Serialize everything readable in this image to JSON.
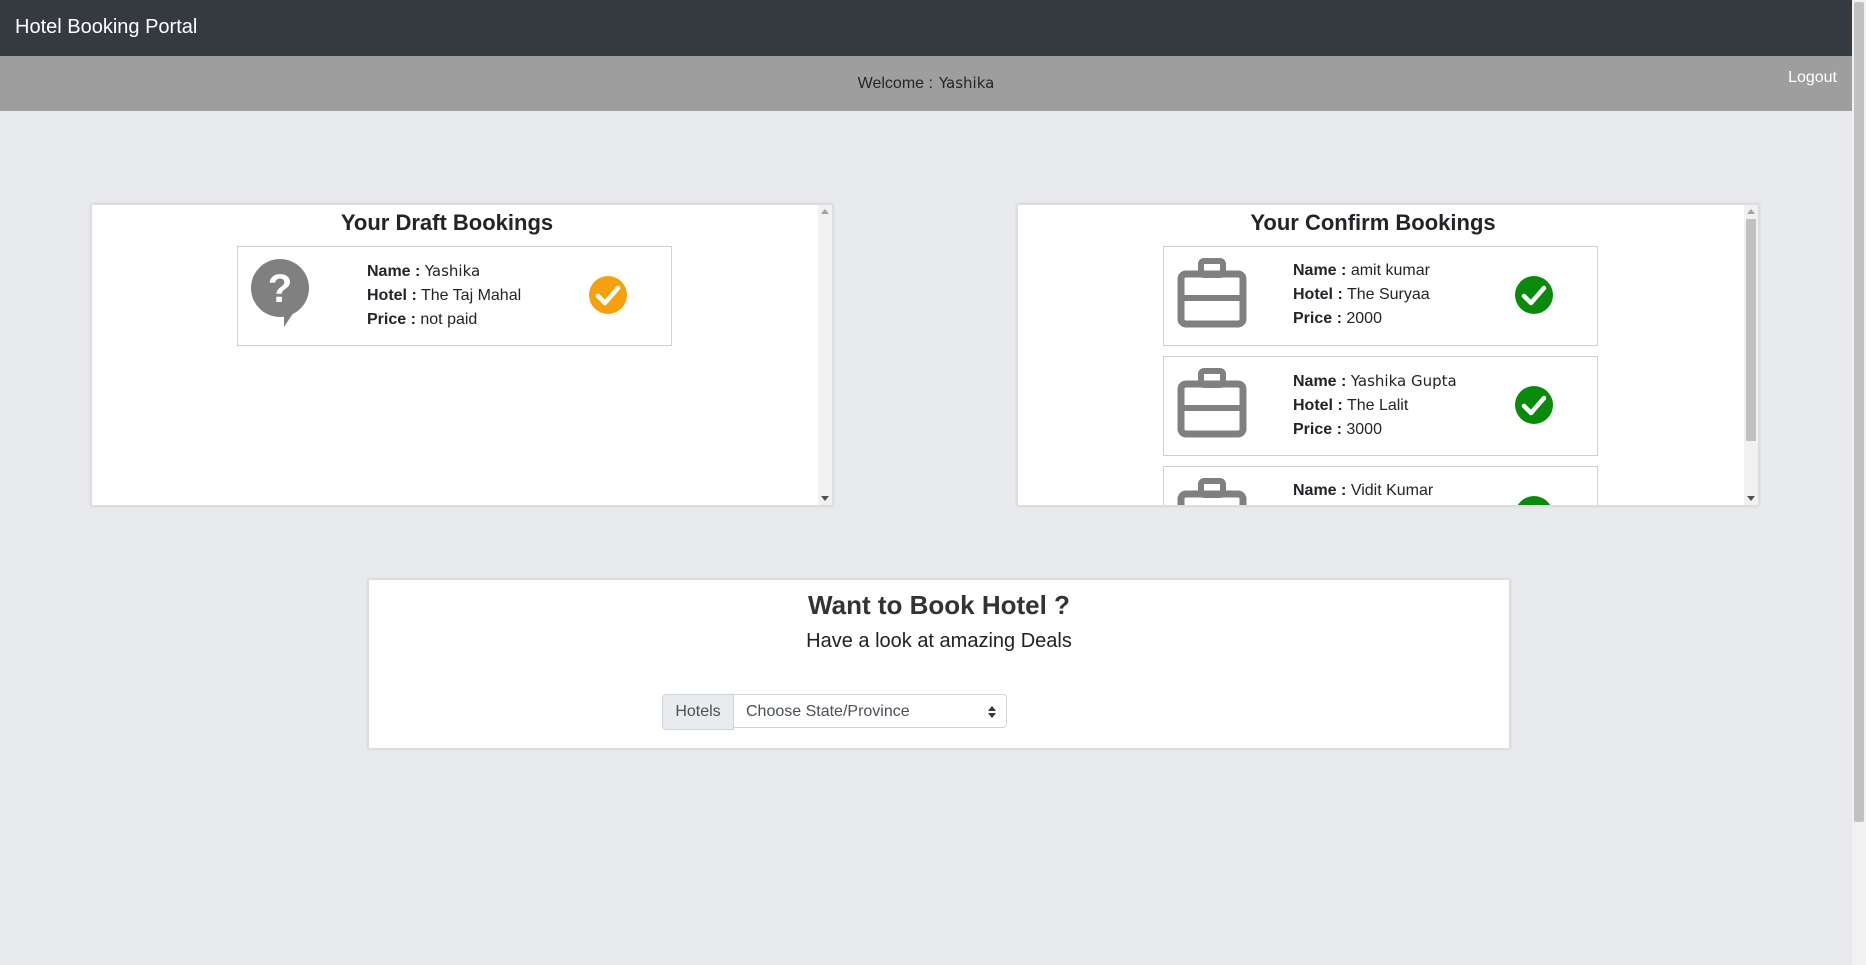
{
  "app": {
    "title": "Hotel Booking Portal"
  },
  "welcome": {
    "label": "Welcome :",
    "user": "Yashika",
    "logout": "Logout"
  },
  "draft": {
    "title": "Your Draft Bookings",
    "bookings": [
      {
        "name_label": "Name :",
        "name": "Yashika",
        "hotel_label": "Hotel :",
        "hotel": "The Taj Mahal",
        "price_label": "Price :",
        "price": "not paid"
      }
    ]
  },
  "confirm": {
    "title": "Your Confirm Bookings",
    "bookings": [
      {
        "name_label": "Name :",
        "name": "amit kumar",
        "hotel_label": "Hotel :",
        "hotel": "The Suryaa",
        "price_label": "Price :",
        "price": "2000"
      },
      {
        "name_label": "Name :",
        "name": "Yashika Gupta",
        "hotel_label": "Hotel :",
        "hotel": "The Lalit",
        "price_label": "Price :",
        "price": "3000"
      },
      {
        "name_label": "Name :",
        "name": "Vidit Kumar"
      }
    ]
  },
  "book": {
    "title": "Want to Book Hotel ?",
    "subtitle": "Have a look at amazing Deals",
    "addon_label": "Hotels",
    "select_value": "Choose State/Province"
  },
  "colors": {
    "navbar": "#343a40",
    "welcome_bar": "#9e9e9e",
    "draft_status": "#f5a00f",
    "confirm_status": "#0a8a0a",
    "icon_gray": "#808080"
  },
  "icons": {
    "draft": "question-bubble-icon",
    "confirm": "briefcase-icon",
    "status": "check-circle-icon"
  }
}
